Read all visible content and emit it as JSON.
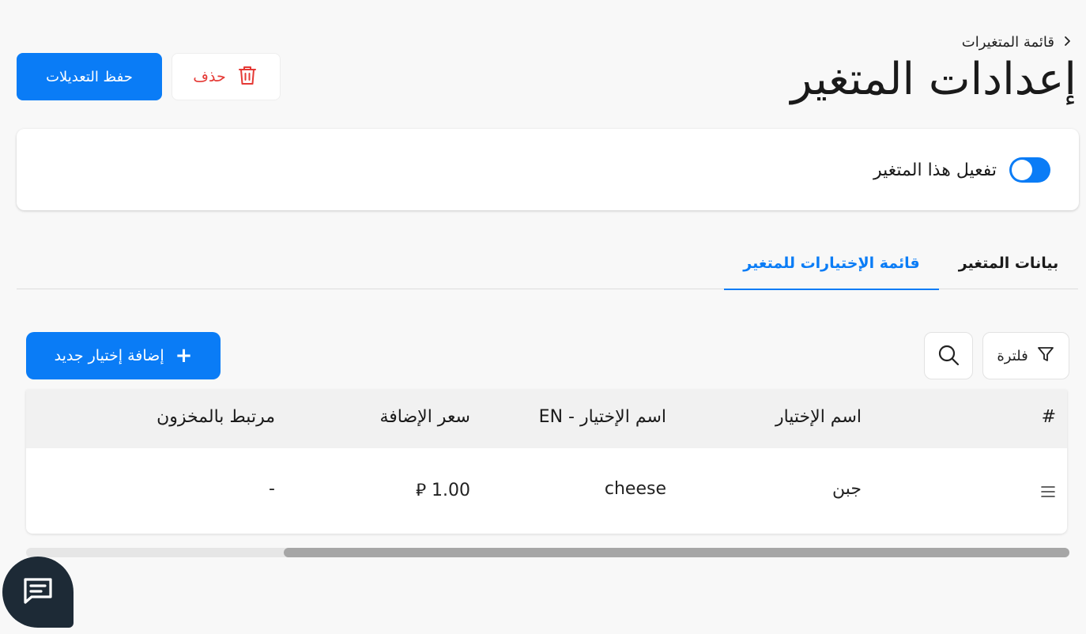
{
  "breadcrumb": {
    "parent": "قائمة المتغيرات"
  },
  "page": {
    "title": "إعدادات المتغير"
  },
  "actions": {
    "save_label": "حفظ التعديلات",
    "delete_label": "حذف"
  },
  "settings": {
    "activate_label": "تفعيل هذا المتغير",
    "activate_on": true
  },
  "tabs": [
    {
      "label": "بيانات المتغير",
      "active": false
    },
    {
      "label": "قائمة الإختيارات للمتغير",
      "active": true
    }
  ],
  "toolbar": {
    "filter_label": "فلترة",
    "add_label": "إضافة إختيار جديد",
    "add_symbol": "+"
  },
  "table": {
    "columns": [
      "#",
      "اسم الإختيار",
      "اسم الإختيار - EN",
      "سعر الإضافة",
      "مرتبط بالمخزون"
    ],
    "rows": [
      {
        "name": "جبن",
        "name_en": "cheese",
        "price": "1.00 ⃁",
        "stock": "-"
      }
    ]
  },
  "colors": {
    "accent": "#0a7cf6",
    "danger": "#e53935",
    "chat_bg": "#1d2a36"
  },
  "icons": [
    "chevron-right-icon",
    "trash-icon",
    "filter-icon",
    "search-icon",
    "plus-icon",
    "drag-handle-icon",
    "chat-icon"
  ]
}
